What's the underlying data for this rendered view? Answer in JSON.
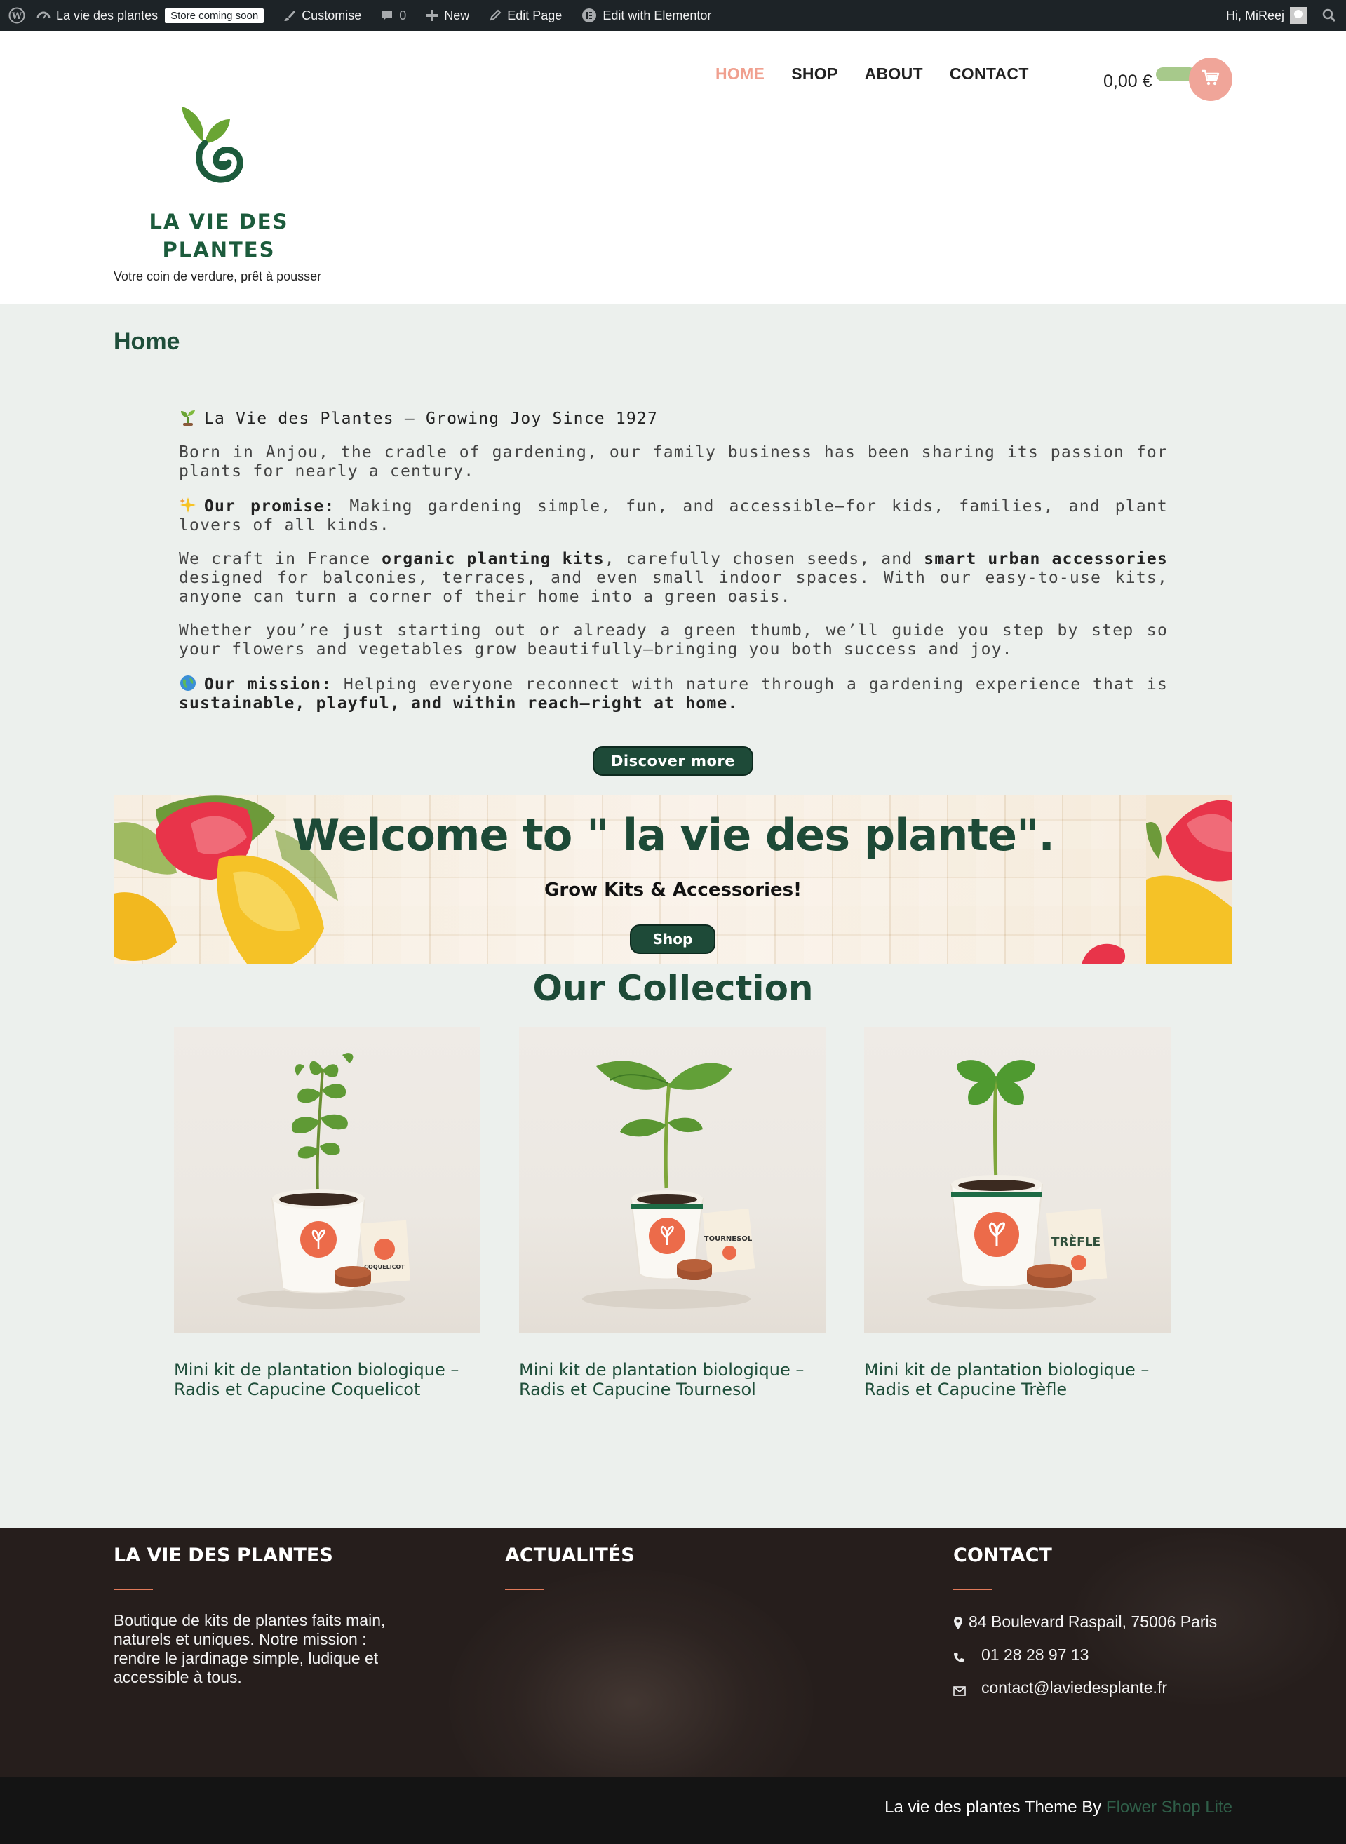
{
  "adminbar": {
    "site_name": "La vie des plantes",
    "store_badge": "Store coming soon",
    "customise": "Customise",
    "comments_count": "0",
    "new": "New",
    "edit_page": "Edit Page",
    "edit_elementor": "Edit with Elementor",
    "greeting": "Hi, MiReej"
  },
  "header": {
    "logo_line1": "LA VIE DES",
    "logo_line2": "PLANTES",
    "tagline": "Votre coin de verdure, prêt à pousser",
    "nav": [
      "HOME",
      "SHOP",
      "ABOUT",
      "CONTACT"
    ],
    "cart_total": "0,00 €"
  },
  "main": {
    "page_title": "Home",
    "intro": {
      "heading": "La Vie des Plantes – Growing Joy Since 1927",
      "p1": "Born in Anjou, the cradle of gardening, our family business has been sharing its passion for plants for nearly a century.",
      "p2_strong": "Our promise:",
      "p2_rest": " Making gardening simple, fun, and accessible—for kids, families, and plant lovers of all kinds.",
      "p3_a": "We craft in France ",
      "p3_b": "organic planting kits",
      "p3_c": ", carefully chosen seeds, and ",
      "p3_d": "smart urban accessories",
      "p3_e": " designed for balconies, terraces, and even small indoor spaces. With our easy-to-use kits, anyone can turn a corner of their home into a green oasis.",
      "p4": "Whether you’re just starting out or already a green thumb, we’ll guide you step by step so your flowers and vegetables grow beautifully—bringing you both success and joy.",
      "p5_strong": "Our mission:",
      "p5_rest": " Helping everyone reconnect with nature through a gardening experience that is ",
      "p5_end": "sustainable, playful, and within reach—right at home."
    },
    "discover_button": "Discover more",
    "banner": {
      "title": "Welcome to \" la vie des plante\".",
      "subtitle": "Grow Kits & Accessories!",
      "button": "Shop"
    },
    "collection_title": "Our Collection",
    "products": [
      {
        "name": "Mini kit de plantation biologique – Radis et Capucine Coquelicot",
        "card_label": "COQUELICOT"
      },
      {
        "name": "Mini kit de plantation biologique – Radis et Capucine Tournesol",
        "card_label": "TOURNESOL"
      },
      {
        "name": "Mini kit de plantation biologique – Radis et Capucine Trèfle",
        "card_label": "TRÈFLE"
      }
    ]
  },
  "footer": {
    "col1_title": "LA VIE DES PLANTES",
    "col1_text": "Boutique de kits de plantes faits main, naturels et uniques. Notre mission : rendre le jardinage simple, ludique et accessible à tous.",
    "col2_title": "ACTUALITÉS",
    "col3_title": "CONTACT",
    "address": "84 Boulevard Raspail, 75006 Paris",
    "phone": "01 28 28 97 13",
    "email": "contact@laviedesplante.fr",
    "credit_prefix": "La vie des plantes Theme By ",
    "credit_link": "Flower Shop Lite"
  },
  "colors": {
    "brand_green": "#1e4a38",
    "nav_active": "#f0a08f",
    "cart_circle": "#f0a599",
    "cart_pill": "#a7c98b",
    "footer_accent": "#e07a5a"
  },
  "icons": [
    "wordpress-icon",
    "dashboard-icon",
    "brush-icon",
    "comment-icon",
    "plus-icon",
    "pencil-icon",
    "elementor-icon",
    "search-icon",
    "cart-icon",
    "location-icon",
    "phone-icon",
    "mail-icon"
  ]
}
